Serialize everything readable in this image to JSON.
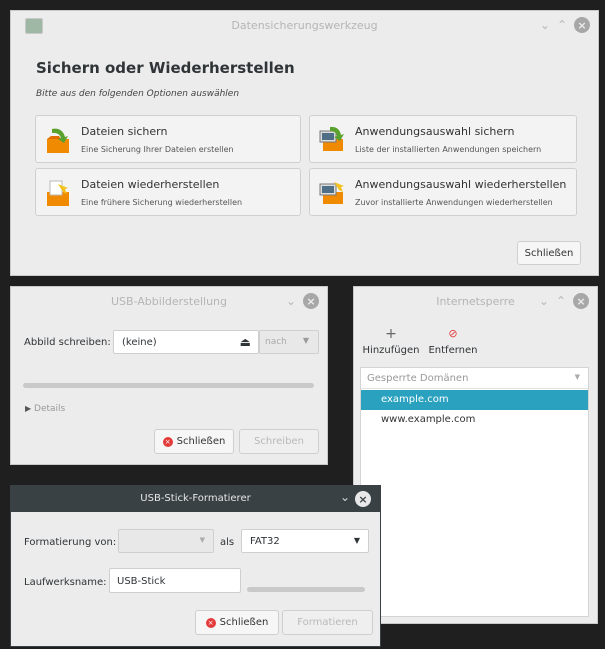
{
  "backup": {
    "title": "Datensicherungswerkzeug",
    "heading": "Sichern oder Wiederherstellen",
    "subtitle": "Bitte aus den folgenden Optionen auswählen",
    "options": [
      {
        "title": "Dateien sichern",
        "desc": "Eine Sicherung Ihrer Dateien erstellen"
      },
      {
        "title": "Anwendungsauswahl sichern",
        "desc": "Liste der installierten Anwendungen speichern"
      },
      {
        "title": "Dateien wiederherstellen",
        "desc": "Eine frühere Sicherung wiederherstellen"
      },
      {
        "title": "Anwendungsauswahl wiederherstellen",
        "desc": "Zuvor installierte Anwendungen wiederherstellen"
      }
    ],
    "close_label": "Schließen"
  },
  "image_writer": {
    "title": "USB-Abbilderstellung",
    "write_label": "Abbild schreiben:",
    "image_value": "(keine)",
    "to_label": "nach",
    "details_label": "Details",
    "close_label": "Schließen",
    "write_button": "Schreiben"
  },
  "domain_blocker": {
    "title": "Internetsperre",
    "add_label": "Hinzufügen",
    "remove_label": "Entfernen",
    "column_header": "Gesperrte Domänen",
    "domains": [
      "example.com",
      "www.example.com"
    ],
    "selected_index": 0
  },
  "formatter": {
    "title": "USB-Stick-Formatierer",
    "format_from_label": "Formatierung von:",
    "as_label": "als",
    "filesystem_value": "FAT32",
    "drive_name_label": "Laufwerksname:",
    "drive_name_value": "USB-Stick",
    "close_label": "Schließen",
    "format_button": "Formatieren"
  },
  "colors": {
    "selection": "#2aa1bf",
    "dark_titlebar": "#3a4145",
    "window_bg": "#ececec",
    "danger": "#e33b3b"
  },
  "icons": [
    "backup-app-icon",
    "folder-backup-icon",
    "folder-restore-icon",
    "computer-backup-icon",
    "computer-restore-icon",
    "lock-icon",
    "chevron-down-icon",
    "plus-icon",
    "remove-icon",
    "triangle-right-icon",
    "close-icon"
  ]
}
